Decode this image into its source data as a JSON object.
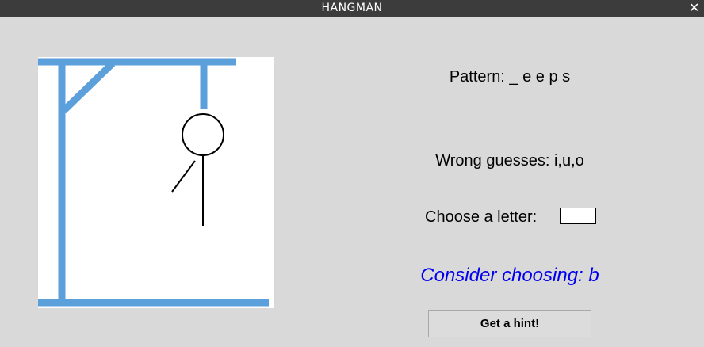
{
  "window": {
    "title": "HANGMAN",
    "close_icon": "close-icon",
    "close_glyph": "✕"
  },
  "game": {
    "pattern_text": "Pattern: _ e e p s",
    "wrong_guesses_text": "Wrong guesses: i,u,o",
    "choose_label": "Choose a letter:",
    "letter_input_value": "",
    "hint_text": "Consider choosing: b",
    "hint_button_label": "Get a hint!",
    "wrong_guess_count": 3
  },
  "colors": {
    "gallows": "#5b9fdb",
    "figure": "#000000",
    "hint": "#0000ee",
    "background": "#d9d9d9",
    "titlebar": "#3c3c3c"
  }
}
